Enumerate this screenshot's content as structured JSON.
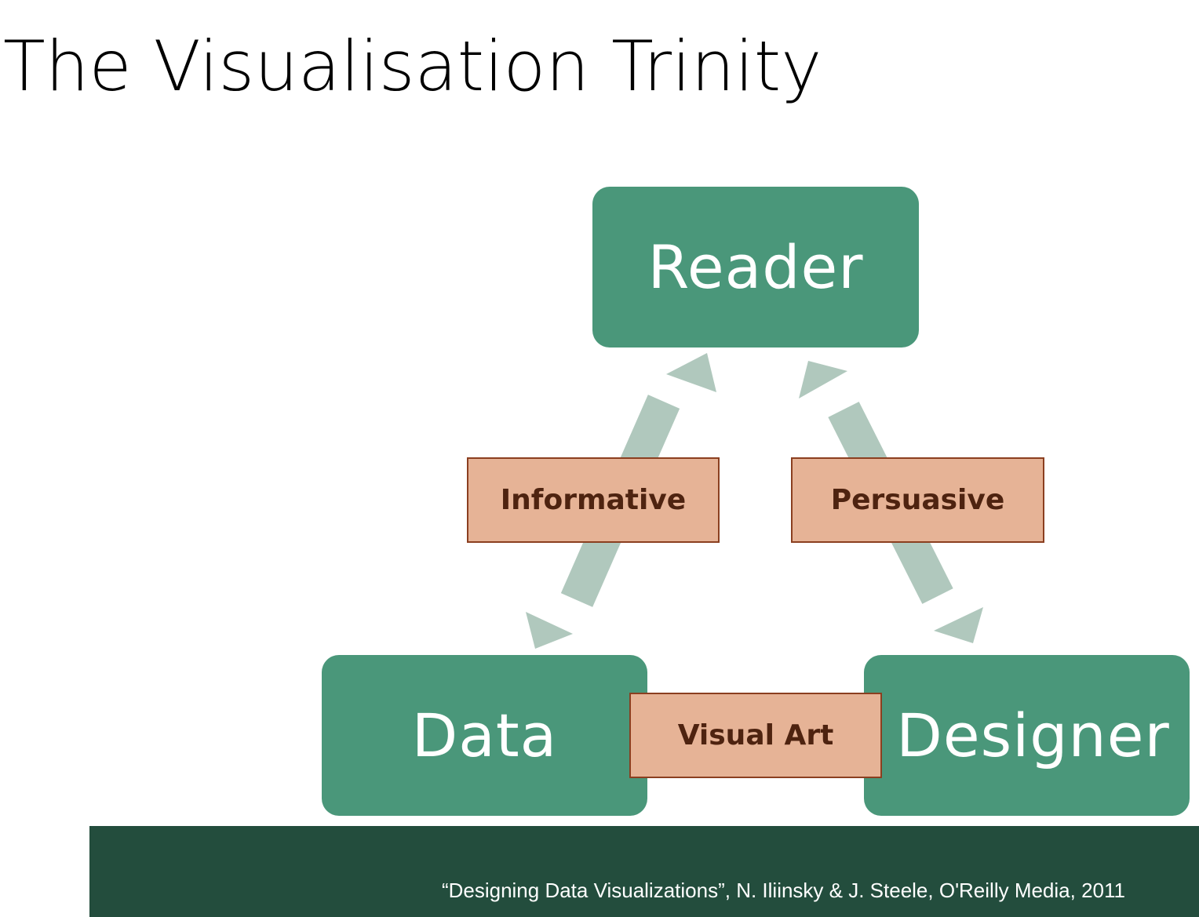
{
  "title": "The Visualisation Trinity",
  "nodes": {
    "reader": "Reader",
    "data": "Data",
    "designer": "Designer"
  },
  "relations": {
    "informative": "Informative",
    "persuasive": "Persuasive",
    "visual_art": "Visual Art"
  },
  "citation": "“Designing Data Visualizations”, N. Iliinsky & J. Steele, O'Reilly Media, 2011",
  "colors": {
    "node": "#4a977a",
    "label_fill": "#e6b396",
    "label_border": "#8b3f20",
    "label_text": "#4e2310",
    "arrow": "#b0c8bd",
    "footer": "#234d3d"
  }
}
